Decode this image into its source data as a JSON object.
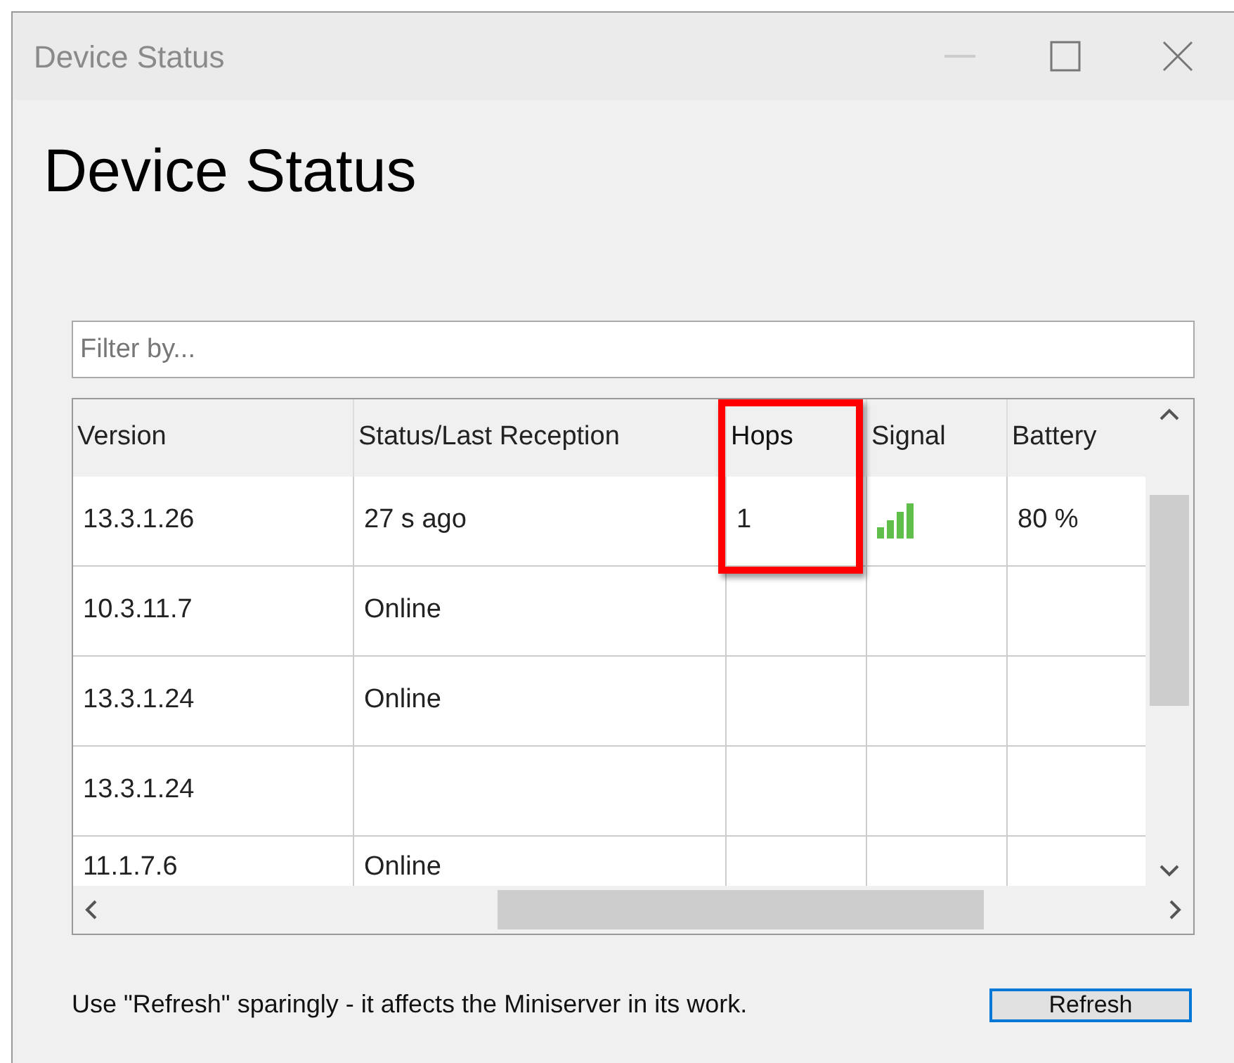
{
  "window": {
    "title": "Device Status"
  },
  "heading": "Device Status",
  "filter": {
    "placeholder": "Filter by..."
  },
  "table": {
    "columns": [
      {
        "label": "Version",
        "highlighted": false
      },
      {
        "label": "Status/Last Reception",
        "highlighted": false
      },
      {
        "label": "Hops",
        "highlighted": true
      },
      {
        "label": "Signal",
        "highlighted": false
      },
      {
        "label": "Battery",
        "highlighted": false
      }
    ],
    "rows": [
      {
        "version": "13.3.1.26",
        "status": "27 s ago",
        "hops": "1",
        "signal": true,
        "battery": "80 %"
      },
      {
        "version": "10.3.11.7",
        "status": "Online",
        "signal": false
      },
      {
        "version": "13.3.1.24",
        "status": "Online",
        "signal": false
      },
      {
        "version": "13.3.1.24",
        "signal": false
      },
      {
        "version": "11.1.7.6",
        "status": "Online",
        "signal": false
      }
    ]
  },
  "footer": {
    "note": "Use \"Refresh\" sparingly - it affects the Miniserver in its work.",
    "button": "Refresh"
  }
}
